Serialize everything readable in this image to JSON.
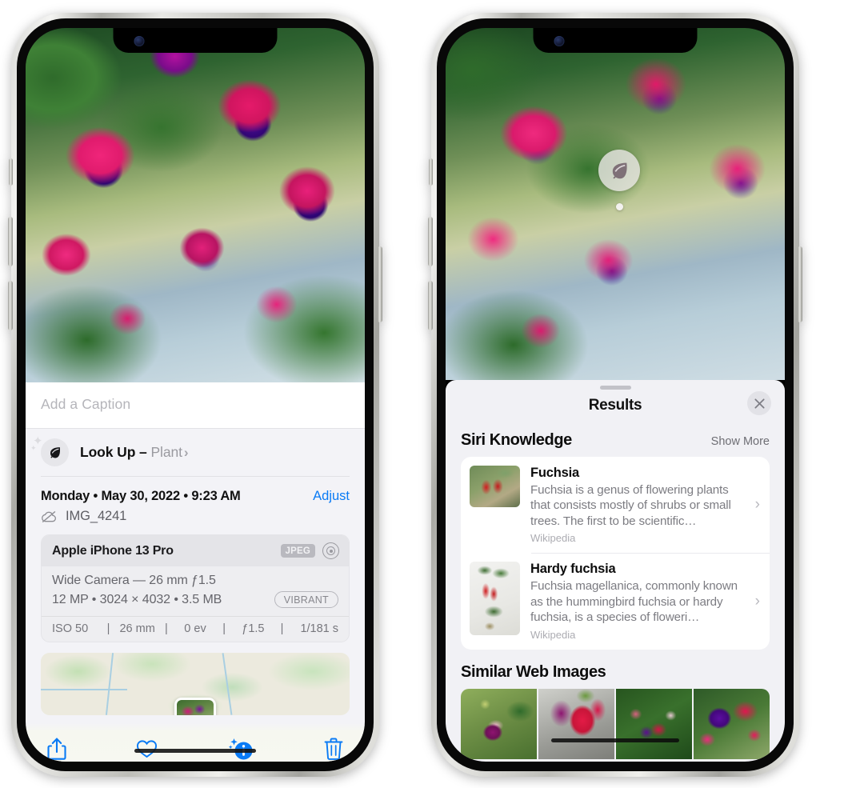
{
  "left_phone": {
    "photo_alt": "fuchsia-flowers-photo",
    "caption_placeholder": "Add a Caption",
    "caption_value": "",
    "lookup": {
      "icon": "leaf-icon",
      "label": "Look Up – ",
      "subject": "Plant",
      "chevron": "›"
    },
    "datetime": "Monday • May 30, 2022 • 9:23 AM",
    "adjust_label": "Adjust",
    "filename": "IMG_4241",
    "cloud_icon": "cloud-slash-icon",
    "exif": {
      "device": "Apple iPhone 13 Pro",
      "format_badge": "JPEG",
      "raw_icon": "aperture-icon",
      "lens_line": "Wide Camera — 26 mm ƒ1.5",
      "spec_line": "12 MP • 3024 × 4032 • 3.5 MB",
      "style_badge": "VIBRANT",
      "stats": [
        "ISO 50",
        "26 mm",
        "0 ev",
        "ƒ1.5",
        "1/181 s"
      ],
      "separator": "|"
    },
    "toolbar": [
      {
        "name": "share-icon",
        "label": "Share"
      },
      {
        "name": "heart-icon",
        "label": "Favorite"
      },
      {
        "name": "info-sparkle-icon",
        "label": "Info"
      },
      {
        "name": "trash-icon",
        "label": "Delete"
      }
    ]
  },
  "right_phone": {
    "photo_alt": "fuchsia-flowers-photo",
    "leaf_badge_icon": "leaf-icon",
    "sheet": {
      "title": "Results",
      "close_label": "✕",
      "sections": [
        {
          "title": "Siri Knowledge",
          "action": "Show More",
          "cards": [
            {
              "title": "Fuchsia",
              "description": "Fuchsia is a genus of flowering plants that consists mostly of shrubs or small trees. The first to be scientific…",
              "source": "Wikipedia",
              "chevron": "›"
            },
            {
              "title": "Hardy fuchsia",
              "description": "Fuchsia magellanica, commonly known as the hummingbird fuchsia or hardy fuchsia, is a species of floweri…",
              "source": "Wikipedia",
              "chevron": "›"
            }
          ]
        },
        {
          "title": "Similar Web Images",
          "images": [
            "web-image-1",
            "web-image-2",
            "web-image-3",
            "web-image-4"
          ]
        }
      ]
    }
  },
  "colors": {
    "accent": "#0a7bf5",
    "sheet_bg": "#f1f1f5",
    "card_bg": "#ffffff",
    "muted_text": "#7c7c82"
  }
}
